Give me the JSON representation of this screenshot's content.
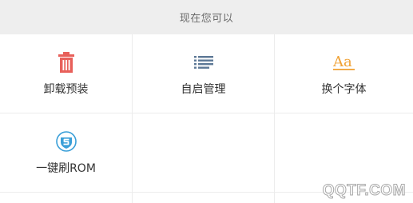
{
  "header": {
    "title": "现在您可以"
  },
  "grid": {
    "items": [
      {
        "label": "卸载预装",
        "icon": "trash-icon",
        "color": "#e8605a"
      },
      {
        "label": "自启管理",
        "icon": "list-icon",
        "color": "#5d7896"
      },
      {
        "label": "换个字体",
        "icon": "font-icon",
        "color": "#f0a236"
      },
      {
        "label": "一键刷ROM",
        "icon": "shield-s-icon",
        "color": "#3a9fd8"
      }
    ]
  },
  "watermark": {
    "text": "QQTF.COM"
  }
}
